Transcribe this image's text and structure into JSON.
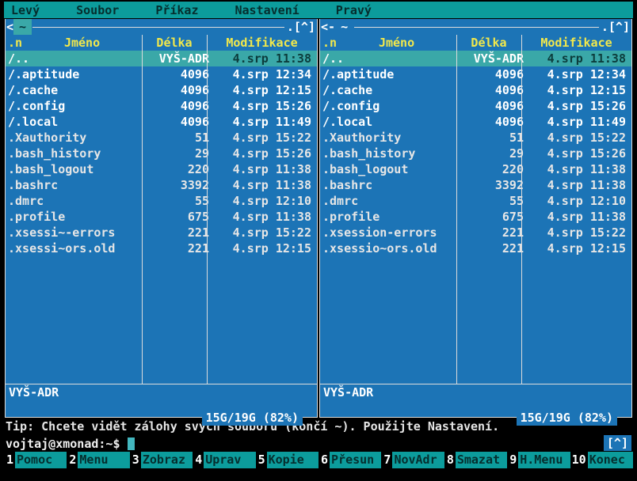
{
  "colors": {
    "panel_bg": "#1c74b6",
    "menubar_bg": "#0c9c9c",
    "selection_bg": "#3aa8a8",
    "header_fg": "#f2e84b",
    "frame_fg": "#dcdcdc",
    "dir_fg": "#ffffff",
    "file_fg": "#e6e6e6"
  },
  "menu": {
    "items": [
      {
        "label": "Levý"
      },
      {
        "label": "Soubor"
      },
      {
        "label": "Příkaz"
      },
      {
        "label": "Nastavení"
      },
      {
        "label": "Pravý"
      }
    ]
  },
  "columns": {
    "sort": ".n",
    "name": "Jméno",
    "size": "Délka",
    "mtime": "Modifikace"
  },
  "panels": {
    "left": {
      "title_prefix": "<",
      "path": "~",
      "corner": ".[^]",
      "mini_status": "VYŠ-ADR",
      "summary": "15G/19G (82%)",
      "rows": [
        {
          "name": "/..",
          "size": "VYŠ-ADR",
          "mtime": "4.srp 11:38"
        },
        {
          "name": "/.aptitude",
          "size": "4096",
          "mtime": "4.srp 12:34"
        },
        {
          "name": "/.cache",
          "size": "4096",
          "mtime": "4.srp 12:15"
        },
        {
          "name": "/.config",
          "size": "4096",
          "mtime": "4.srp 15:26"
        },
        {
          "name": "/.local",
          "size": "4096",
          "mtime": "4.srp 11:49"
        },
        {
          "name": ".Xauthority",
          "size": "51",
          "mtime": "4.srp 15:22"
        },
        {
          "name": ".bash_history",
          "size": "29",
          "mtime": "4.srp 15:26"
        },
        {
          "name": ".bash_logout",
          "size": "220",
          "mtime": "4.srp 11:38"
        },
        {
          "name": ".bashrc",
          "size": "3392",
          "mtime": "4.srp 11:38"
        },
        {
          "name": ".dmrc",
          "size": "55",
          "mtime": "4.srp 12:10"
        },
        {
          "name": ".profile",
          "size": "675",
          "mtime": "4.srp 11:38"
        },
        {
          "name": ".xsessi~-errors",
          "size": "221",
          "mtime": "4.srp 15:22"
        },
        {
          "name": ".xsessi~ors.old",
          "size": "221",
          "mtime": "4.srp 12:15"
        }
      ]
    },
    "right": {
      "title_prefix": "<-",
      "path": "~",
      "corner": ".[^]",
      "mini_status": "VYŠ-ADR",
      "summary": "15G/19G (82%)",
      "rows": [
        {
          "name": "/..",
          "size": "VYŠ-ADR",
          "mtime": "4.srp 11:38"
        },
        {
          "name": "/.aptitude",
          "size": "4096",
          "mtime": "4.srp 12:34"
        },
        {
          "name": "/.cache",
          "size": "4096",
          "mtime": "4.srp 12:15"
        },
        {
          "name": "/.config",
          "size": "4096",
          "mtime": "4.srp 15:26"
        },
        {
          "name": "/.local",
          "size": "4096",
          "mtime": "4.srp 11:49"
        },
        {
          "name": ".Xauthority",
          "size": "51",
          "mtime": "4.srp 15:22"
        },
        {
          "name": ".bash_history",
          "size": "29",
          "mtime": "4.srp 15:26"
        },
        {
          "name": ".bash_logout",
          "size": "220",
          "mtime": "4.srp 11:38"
        },
        {
          "name": ".bashrc",
          "size": "3392",
          "mtime": "4.srp 11:38"
        },
        {
          "name": ".dmrc",
          "size": "55",
          "mtime": "4.srp 12:10"
        },
        {
          "name": ".profile",
          "size": "675",
          "mtime": "4.srp 11:38"
        },
        {
          "name": ".xsession-errors",
          "size": "221",
          "mtime": "4.srp 15:22"
        },
        {
          "name": ".xsessio~ors.old",
          "size": "221",
          "mtime": "4.srp 12:15"
        }
      ]
    }
  },
  "hint": "Tip: Chcete vidět zálohy svých souborů (končí ~). Použijte Nastavení.",
  "prompt": "vojtaj@xmonad:~$",
  "panel_toggle": "[^]",
  "fnkeys": [
    {
      "num": "1",
      "label": "Pomoc"
    },
    {
      "num": "2",
      "label": "Menu"
    },
    {
      "num": "3",
      "label": "Zobraz"
    },
    {
      "num": "4",
      "label": "Uprav"
    },
    {
      "num": "5",
      "label": "Kopie"
    },
    {
      "num": "6",
      "label": "Přesun"
    },
    {
      "num": "7",
      "label": "NovAdr"
    },
    {
      "num": "8",
      "label": "Smazat"
    },
    {
      "num": "9",
      "label": "H.Menu"
    },
    {
      "num": "10",
      "label": "Konec"
    }
  ]
}
